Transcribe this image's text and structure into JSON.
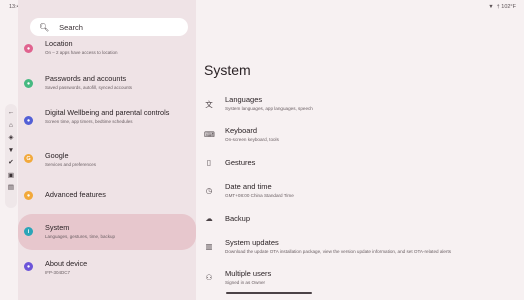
{
  "status_bar": {
    "time": "13:40",
    "left_icons": [
      "⚙",
      "↓",
      "○"
    ],
    "right_icons": [
      "▼"
    ],
    "battery": "† 102°F"
  },
  "taskbar": {
    "icons": [
      "←",
      "⌂",
      "◈",
      "▼",
      "✔",
      "▣",
      "▤"
    ]
  },
  "search": {
    "placeholder": "Search"
  },
  "left_menu": [
    {
      "title": "Location",
      "subtitle": "On – 2 apps have access to location",
      "color": "#e0638f",
      "icon": "location-icon"
    },
    {
      "title": "Passwords and accounts",
      "subtitle": "Saved passwords, autofill, synced accounts",
      "color": "#46b981",
      "icon": "key-icon"
    },
    {
      "title": "Digital Wellbeing and parental controls",
      "subtitle": "Screen time, app timers, bedtime schedules",
      "color": "#5360d6",
      "icon": "wellbeing-icon"
    },
    {
      "title": "Google",
      "subtitle": "Services and preferences",
      "color": "#f2a93b",
      "icon": "google-icon"
    },
    {
      "title": "Advanced features",
      "subtitle": "",
      "color": "#f2a93b",
      "icon": "star-icon"
    },
    {
      "title": "System",
      "subtitle": "Languages, gestures, time, backup",
      "color": "#2aa5b8",
      "icon": "info-icon"
    },
    {
      "title": "About device",
      "subtitle": "IFP-304DC7",
      "color": "#6d55d9",
      "icon": "device-icon"
    }
  ],
  "main": {
    "title": "System",
    "items": [
      {
        "title": "Languages",
        "subtitle": "System languages, app languages, speech",
        "icon": "文"
      },
      {
        "title": "Keyboard",
        "subtitle": "On-screen keyboard, tools",
        "icon": "⌨"
      },
      {
        "title": "Gestures",
        "subtitle": "",
        "icon": "▯"
      },
      {
        "title": "Date and time",
        "subtitle": "GMT+08:00 China Standard Time",
        "icon": "◷"
      },
      {
        "title": "Backup",
        "subtitle": "",
        "icon": "☁"
      },
      {
        "title": "System updates",
        "subtitle": "Download the update OTA installation package, view the version update information, and set OTA-related alerts",
        "icon": "▥"
      },
      {
        "title": "Multiple users",
        "subtitle": "Signed in as Owner",
        "icon": "⚇"
      }
    ]
  }
}
